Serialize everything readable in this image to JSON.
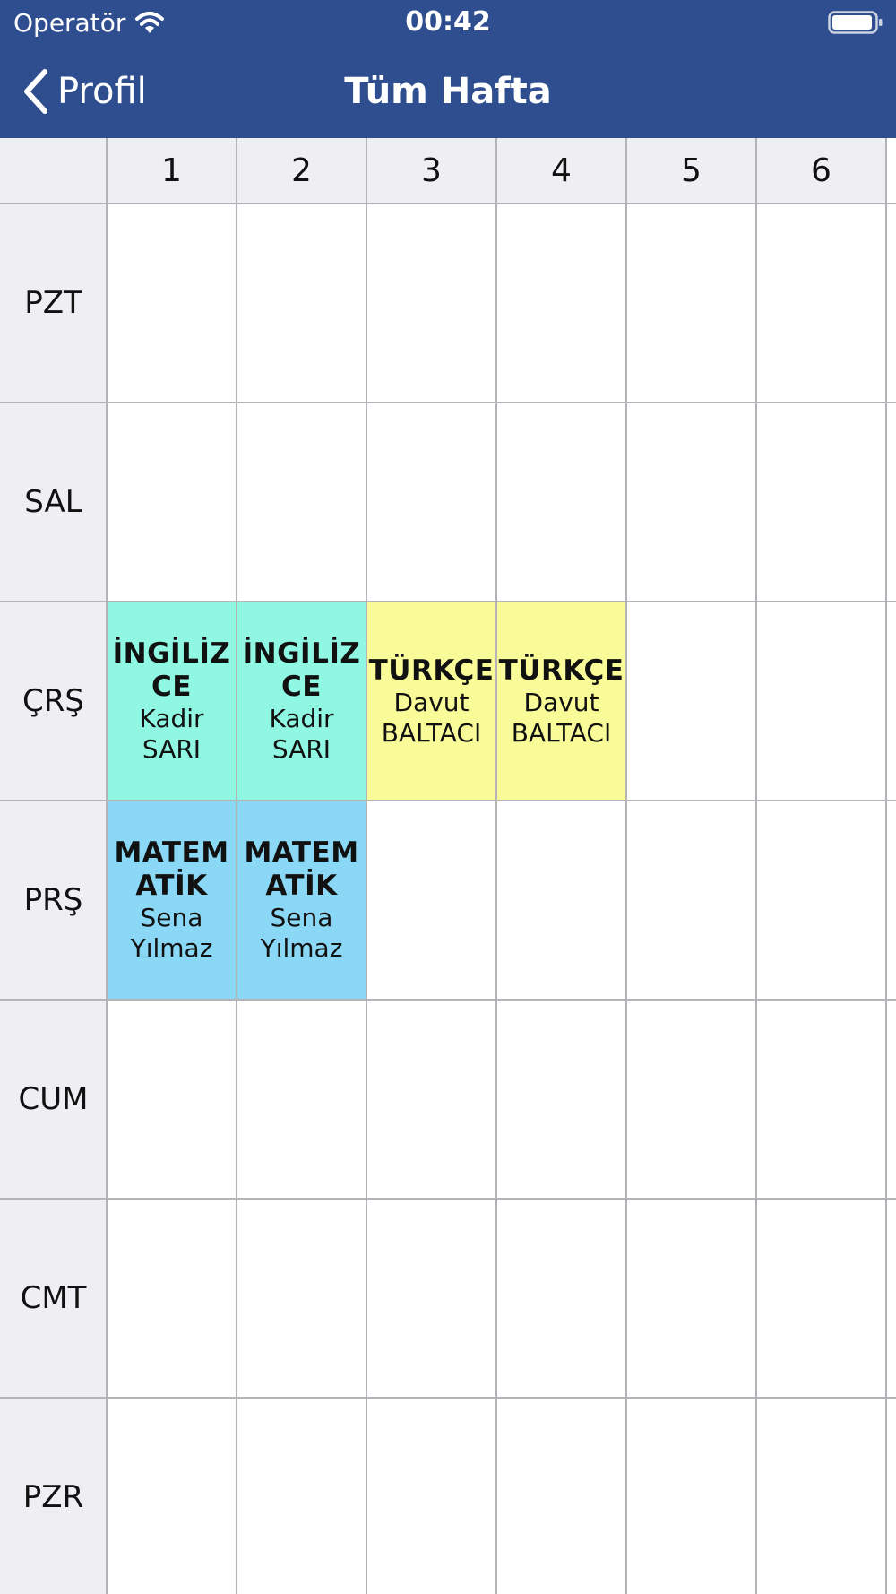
{
  "status_bar": {
    "carrier": "Operatör",
    "time": "00:42"
  },
  "nav": {
    "back_label": "Profil",
    "title": "Tüm Hafta"
  },
  "periods": [
    "1",
    "2",
    "3",
    "4",
    "5",
    "6"
  ],
  "days": [
    "PZT",
    "SAL",
    "ÇRŞ",
    "PRŞ",
    "CUM",
    "CMT",
    "PZR"
  ],
  "entries": [
    {
      "day": 2,
      "period": 0,
      "course_lines": [
        "İNGİLİZ",
        "CE"
      ],
      "teacher_lines": [
        "Kadir",
        "SARI"
      ],
      "color": "#8ff7e2"
    },
    {
      "day": 2,
      "period": 1,
      "course_lines": [
        "İNGİLİZ",
        "CE"
      ],
      "teacher_lines": [
        "Kadir",
        "SARI"
      ],
      "color": "#8ff7e2"
    },
    {
      "day": 2,
      "period": 2,
      "course_lines": [
        "TÜRKÇE"
      ],
      "teacher_lines": [
        "Davut",
        "BALTACI"
      ],
      "color": "#f8fb98"
    },
    {
      "day": 2,
      "period": 3,
      "course_lines": [
        "TÜRKÇE"
      ],
      "teacher_lines": [
        "Davut",
        "BALTACI"
      ],
      "color": "#f8fb98"
    },
    {
      "day": 3,
      "period": 0,
      "course_lines": [
        "MATEM",
        "ATİK"
      ],
      "teacher_lines": [
        "Sena",
        "Yılmaz"
      ],
      "color": "#8ad8f5"
    },
    {
      "day": 3,
      "period": 1,
      "course_lines": [
        "MATEM",
        "ATİK"
      ],
      "teacher_lines": [
        "Sena",
        "Yılmaz"
      ],
      "color": "#8ad8f5"
    }
  ]
}
